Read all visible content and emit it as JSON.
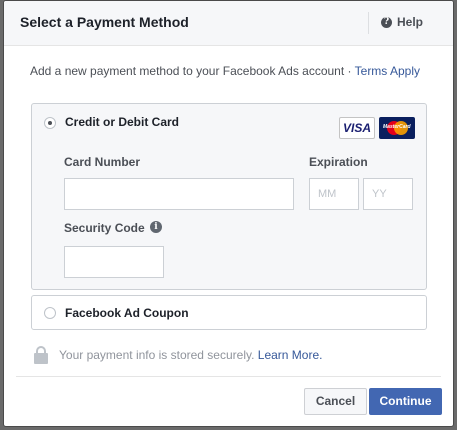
{
  "dialog": {
    "title": "Select a Payment Method",
    "help_label": "Help",
    "help_icon": "?"
  },
  "intro": {
    "text": "Add a new payment method to your Facebook Ads account · ",
    "link_text": "Terms Apply"
  },
  "credit_card": {
    "option_label": "Credit or Debit Card",
    "selected": true,
    "visa_label": "VISA",
    "mastercard_label": "MasterCard",
    "card_number_label": "Card Number",
    "card_number_value": "",
    "expiration_label": "Expiration",
    "month_placeholder": "MM",
    "year_placeholder": "YY",
    "security_code_label": "Security Code",
    "security_code_value": "",
    "info_icon": "i"
  },
  "coupon": {
    "option_label": "Facebook Ad Coupon",
    "selected": false
  },
  "secure_note": {
    "text": "Your payment info is stored securely. ",
    "link_text": "Learn More."
  },
  "buttons": {
    "cancel_label": "Cancel",
    "continue_label": "Continue"
  },
  "colors": {
    "primary": "#4267b2",
    "link": "#365899",
    "panel_bg": "#f6f7f9"
  }
}
